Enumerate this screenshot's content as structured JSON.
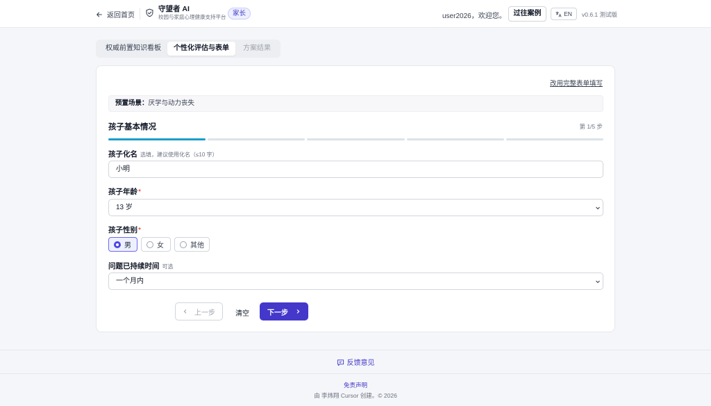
{
  "header": {
    "back_label": "返回首页",
    "brand_title": "守望者 AI",
    "brand_subtitle": "校园与家庭心理健康支持平台",
    "role_badge": "家长",
    "greeting": "user2026，欢迎您。",
    "cases_button": "过往案例",
    "lang_button": "EN",
    "version": "v0.6.1 测试版"
  },
  "tabs": [
    {
      "label": "权威前置知识看板",
      "state": "default"
    },
    {
      "label": "个性化评估与表单",
      "state": "active"
    },
    {
      "label": "方案结果",
      "state": "disabled"
    }
  ],
  "form": {
    "switch_link": "改用完整表单填写",
    "scenario_label": "预置场景：",
    "scenario_value": "厌学与动力丧失",
    "section_title": "孩子基本情况",
    "step_text": "第 1/5 步",
    "progress": {
      "current": 1,
      "total": 5
    },
    "fields": {
      "nickname": {
        "label": "孩子化名",
        "hint": "选填，建议使用化名（≤10 字）",
        "value": "小明"
      },
      "age": {
        "label": "孩子年龄",
        "required_mark": "*",
        "value": "13 岁"
      },
      "gender": {
        "label": "孩子性别",
        "required_mark": "*",
        "options": [
          "男",
          "女",
          "其他"
        ],
        "selected": "男"
      },
      "duration": {
        "label": "问题已持续时间",
        "hint": "可选",
        "value": "一个月内"
      }
    },
    "buttons": {
      "prev": "上一步",
      "clear": "清空",
      "next": "下一步"
    }
  },
  "footer": {
    "feedback": "反馈意见",
    "disclaimer": "免责声明",
    "credit": "由 李炜翔 Cursor 创建。© 2026"
  },
  "colors": {
    "accent": "#4338ca",
    "progress_active": "#1a9ec9",
    "required": "#dc2626"
  }
}
